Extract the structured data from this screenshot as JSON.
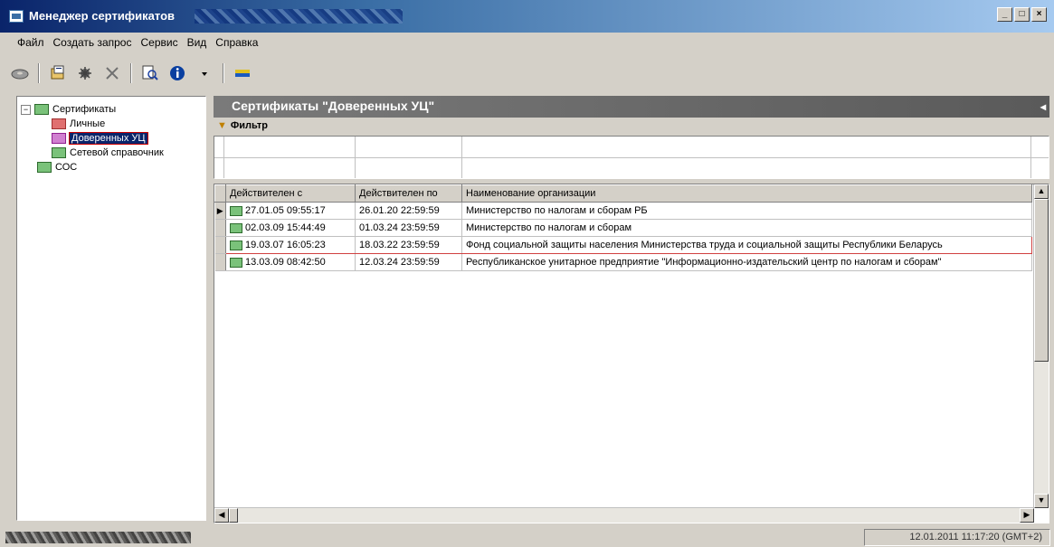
{
  "window": {
    "title": "Менеджер сертификатов",
    "controls": [
      "_",
      "□",
      "×"
    ]
  },
  "menu": [
    "Файл",
    "Создать запрос",
    "Сервис",
    "Вид",
    "Справка"
  ],
  "toolbar": {
    "icons": [
      "disk-icon",
      "import-icon",
      "export-icon",
      "delete-icon",
      "view-icon",
      "info-icon",
      "dropdown-icon",
      "refresh-icon"
    ]
  },
  "tree": {
    "root": "Сертификаты",
    "toggle": "−",
    "children": [
      "Личные",
      "Доверенных УЦ",
      "Сетевой справочник"
    ],
    "selected": "Доверенных УЦ",
    "second_root": "СОС"
  },
  "panel": {
    "title": "Сертификаты \"Доверенных УЦ\"",
    "filter_label": "Фильтр"
  },
  "grid": {
    "columns": [
      "Действителен с",
      "Действителен по",
      "Наименование организации"
    ],
    "rows": [
      {
        "from": "27.01.05 09:55:17",
        "to": "26.01.20 22:59:59",
        "org": "Министерство по налогам и сборам РБ",
        "current": true
      },
      {
        "from": "02.03.09 15:44:49",
        "to": "01.03.24 23:59:59",
        "org": "Министерство по налогам и сборам",
        "current": false
      },
      {
        "from": "19.03.07 16:05:23",
        "to": "18.03.22 23:59:59",
        "org": "Фонд социальной защиты населения Министерства труда и социальной защиты Республики Беларусь",
        "current": false,
        "highlighted": true
      },
      {
        "from": "13.03.09 08:42:50",
        "to": "12.03.24 23:59:59",
        "org": "Республиканское унитарное предприятие \"Информационно-издательский центр по налогам и сборам\"",
        "current": false
      }
    ]
  },
  "status": {
    "datetime": "12.01.2011 11:17:20 (GMT+2)"
  }
}
